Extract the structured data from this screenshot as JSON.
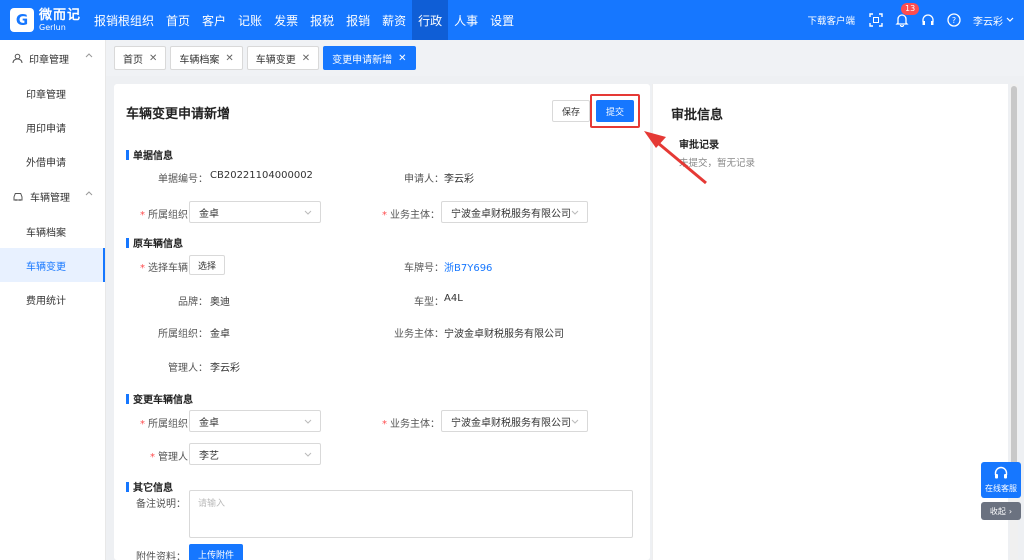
{
  "brand": {
    "name": "微而记",
    "sub": "Gerlun"
  },
  "nav": [
    {
      "label": "报销根组织"
    },
    {
      "label": "首页"
    },
    {
      "label": "客户"
    },
    {
      "label": "记账"
    },
    {
      "label": "发票"
    },
    {
      "label": "报税"
    },
    {
      "label": "报销"
    },
    {
      "label": "薪资"
    },
    {
      "label": "行政"
    },
    {
      "label": "人事"
    },
    {
      "label": "设置"
    }
  ],
  "nav_active": "行政",
  "topright": {
    "download": "下载客户端",
    "notice_count": "13",
    "user": "李云彩"
  },
  "sidebar": {
    "group1": "印章管理",
    "items1": [
      "印章管理",
      "用印申请",
      "外借申请"
    ],
    "group2": "车辆管理",
    "items2": [
      "车辆档案",
      "车辆变更",
      "费用统计"
    ]
  },
  "tabs": [
    {
      "label": "首页"
    },
    {
      "label": "车辆档案"
    },
    {
      "label": "车辆变更"
    },
    {
      "label": "变更申请新增"
    }
  ],
  "form": {
    "title": "车辆变更申请新增",
    "save": "保存",
    "submit": "提交",
    "sec_doc": "单据信息",
    "doc_no_label": "单据编号：",
    "doc_no": "CB20221104000002",
    "applicant_label": "申请人：",
    "applicant": "李云彩",
    "org_label": "所属组织：",
    "org": "金卓",
    "subject_label": "业务主体：",
    "subject": "宁波金卓财税服务有限公司",
    "sec_orig": "原车辆信息",
    "choose_label": "选择车辆：",
    "choose_btn": "选择",
    "plate_label": "车牌号：",
    "plate": "浙B7Y696",
    "brand_label": "品牌：",
    "brand": "奥迪",
    "model_label": "车型：",
    "model": "A4L",
    "orig_org_label": "所属组织：",
    "orig_org": "金卓",
    "orig_subject_label": "业务主体：",
    "orig_subject": "宁波金卓财税服务有限公司",
    "manager_label": "管理人：",
    "manager": "李云彩",
    "sec_change": "变更车辆信息",
    "new_org_label": "所属组织：",
    "new_org": "金卓",
    "new_subject_label": "业务主体：",
    "new_subject": "宁波金卓财税服务有限公司",
    "new_manager_label": "管理人：",
    "new_manager": "李艺",
    "sec_other": "其它信息",
    "remark_label": "备注说明：",
    "remark_placeholder": "请输入",
    "attach_label": "附件资料：",
    "upload": "上传附件"
  },
  "approval": {
    "title": "审批信息",
    "record": "审批记录",
    "empty": "未提交，暂无记录"
  },
  "float": {
    "service": "在线客服",
    "collapse": "收起"
  },
  "colors": {
    "primary": "#1677ff",
    "highlight": "#e53935"
  }
}
